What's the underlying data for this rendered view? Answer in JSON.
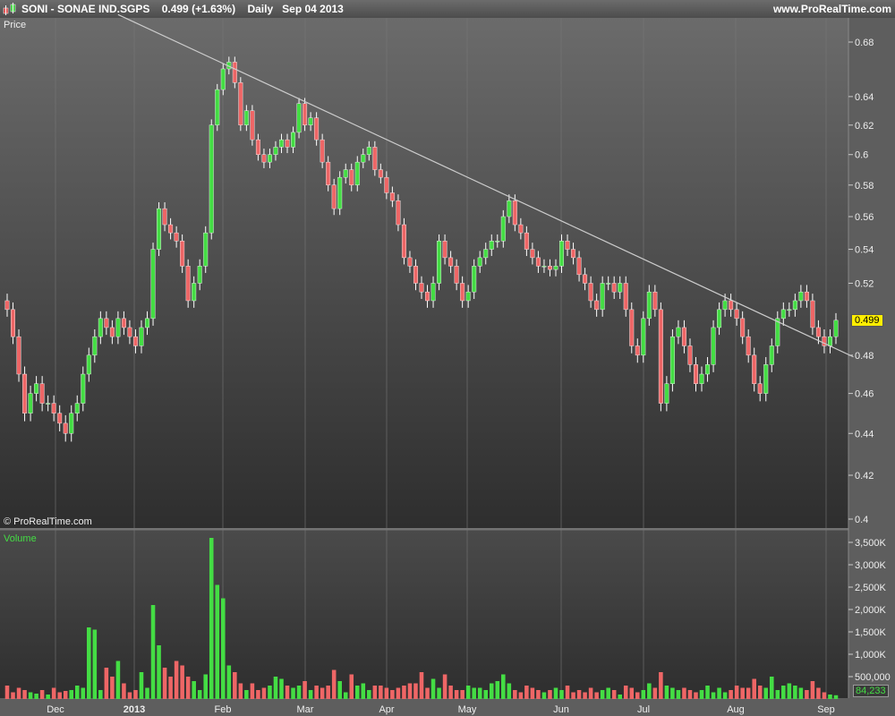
{
  "header": {
    "symbol": "SONI - SONAE IND.SGPS",
    "last": "0.499 (+1.63%)",
    "period": "Daily",
    "date": "Sep 04 2013",
    "site": "www.ProRealTime.com"
  },
  "price_panel": {
    "label": "Price",
    "copyright": "© ProRealTime.com",
    "current_price": "0.499"
  },
  "volume_panel": {
    "label": "Volume",
    "current_volume": "84,233"
  },
  "colors": {
    "up": "#44dd44",
    "down": "#ee6666",
    "trendline": "#cccccc",
    "price_tag": "#ffee00"
  },
  "chart_data": {
    "type": "candlestick",
    "title": "SONI - SONAE IND.SGPS",
    "price_axis": {
      "scale": "log",
      "ylim": [
        0.4,
        0.68
      ],
      "ticks": [
        "0.68",
        "0.64",
        "0.62",
        "0.6",
        "0.58",
        "0.56",
        "0.54",
        "0.52",
        "0.48",
        "0.46",
        "0.44",
        "0.42",
        "0.4"
      ]
    },
    "volume_axis": {
      "ylim": [
        0,
        3740000
      ],
      "ticks": [
        "3,500K",
        "3,000K",
        "2,500K",
        "2,000K",
        "1,500K",
        "1,000K",
        "500,000"
      ]
    },
    "x_ticks": [
      "Dec",
      "2013",
      "Feb",
      "Mar",
      "Apr",
      "May",
      "Jun",
      "Jul",
      "Aug",
      "Sep"
    ],
    "close": [
      0.505,
      0.49,
      0.47,
      0.45,
      0.46,
      0.465,
      0.455,
      0.455,
      0.45,
      0.445,
      0.44,
      0.45,
      0.455,
      0.47,
      0.48,
      0.49,
      0.5,
      0.495,
      0.49,
      0.5,
      0.495,
      0.49,
      0.485,
      0.495,
      0.5,
      0.54,
      0.565,
      0.555,
      0.55,
      0.545,
      0.53,
      0.51,
      0.52,
      0.53,
      0.55,
      0.62,
      0.645,
      0.66,
      0.665,
      0.65,
      0.62,
      0.63,
      0.61,
      0.6,
      0.595,
      0.6,
      0.605,
      0.61,
      0.605,
      0.615,
      0.635,
      0.62,
      0.625,
      0.61,
      0.595,
      0.58,
      0.565,
      0.585,
      0.59,
      0.58,
      0.595,
      0.6,
      0.605,
      0.59,
      0.585,
      0.575,
      0.57,
      0.555,
      0.535,
      0.53,
      0.52,
      0.515,
      0.51,
      0.52,
      0.545,
      0.535,
      0.53,
      0.52,
      0.51,
      0.515,
      0.53,
      0.535,
      0.54,
      0.545,
      0.545,
      0.56,
      0.57,
      0.555,
      0.55,
      0.54,
      0.535,
      0.53,
      0.53,
      0.528,
      0.53,
      0.545,
      0.54,
      0.535,
      0.525,
      0.52,
      0.51,
      0.505,
      0.52,
      0.52,
      0.515,
      0.52,
      0.505,
      0.485,
      0.48,
      0.5,
      0.515,
      0.505,
      0.455,
      0.465,
      0.49,
      0.495,
      0.485,
      0.475,
      0.465,
      0.47,
      0.475,
      0.495,
      0.505,
      0.51,
      0.505,
      0.5,
      0.49,
      0.48,
      0.465,
      0.46,
      0.475,
      0.485,
      0.5,
      0.505,
      0.505,
      0.51,
      0.515,
      0.51,
      0.495,
      0.49,
      0.485,
      0.49,
      0.499
    ],
    "volume": [
      300,
      150,
      250,
      200,
      150,
      120,
      200,
      100,
      250,
      150,
      180,
      200,
      300,
      250,
      1600,
      1550,
      200,
      700,
      500,
      850,
      350,
      150,
      200,
      600,
      250,
      2100,
      1200,
      700,
      500,
      850,
      750,
      500,
      400,
      200,
      550,
      3600,
      2550,
      2250,
      750,
      600,
      350,
      200,
      350,
      200,
      250,
      300,
      500,
      450,
      300,
      250,
      300,
      400,
      200,
      300,
      250,
      300,
      650,
      400,
      150,
      550,
      300,
      350,
      200,
      300,
      300,
      250,
      200,
      250,
      300,
      350,
      350,
      600,
      250,
      450,
      250,
      550,
      300,
      200,
      200,
      300,
      250,
      250,
      200,
      350,
      400,
      550,
      350,
      200,
      150,
      300,
      250,
      200,
      150,
      200,
      250,
      200,
      300,
      150,
      200,
      150,
      250,
      150,
      200,
      250,
      200,
      100,
      300,
      250,
      150,
      200,
      350,
      250,
      600,
      300,
      250,
      200,
      250,
      200,
      150,
      200,
      300,
      150,
      250,
      150,
      200,
      300,
      250,
      250,
      450,
      300,
      250,
      500,
      200,
      300,
      350,
      300,
      250,
      200,
      400,
      250,
      150,
      100,
      84
    ],
    "trendline": [
      [
        35,
        0.668
      ],
      [
        143,
        0.482
      ]
    ]
  }
}
